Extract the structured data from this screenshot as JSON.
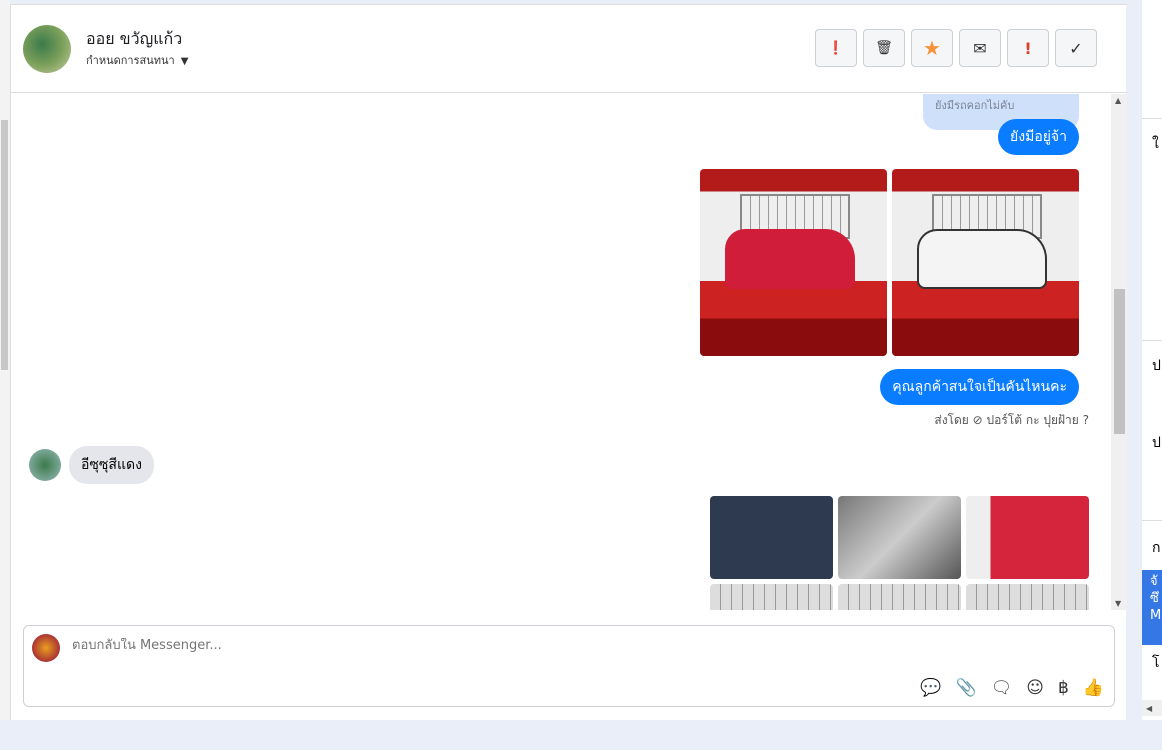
{
  "header": {
    "name": "ออย ขวัญแก้ว",
    "subtitle": "กำหนดการสนทนา",
    "caret": "▼",
    "tools": [
      {
        "name": "spam-button",
        "glyph": "❗"
      },
      {
        "name": "delete-button",
        "glyph": "🗑"
      },
      {
        "name": "star-button",
        "glyph": "★"
      },
      {
        "name": "mail-button",
        "glyph": "✉"
      },
      {
        "name": "important-button",
        "glyph": "!"
      },
      {
        "name": "done-button",
        "glyph": "✓"
      }
    ]
  },
  "messages": {
    "quoted": "ยังมีรถคอกไม่คับ",
    "reply1": "ยังมีอยู่จ้า",
    "reply2": "คุณลูกค้าสนใจเป็นคันไหนคะ",
    "sent_by": "ส่งโดย ⊘ ปอร์โต้ กะ ปุยฝ้าย ?",
    "incoming": "อีซุซุสีแดง"
  },
  "composer": {
    "placeholder": "ตอบกลับใน Messenger..."
  },
  "right": {
    "blue_text": "จั ซึ M",
    "headers": [
      "ใ",
      "ป",
      "ป",
      "ก",
      "โ"
    ]
  },
  "colors": {
    "accent": "#0a7cff",
    "star": "#f7923a",
    "important": "#e03e2d"
  }
}
